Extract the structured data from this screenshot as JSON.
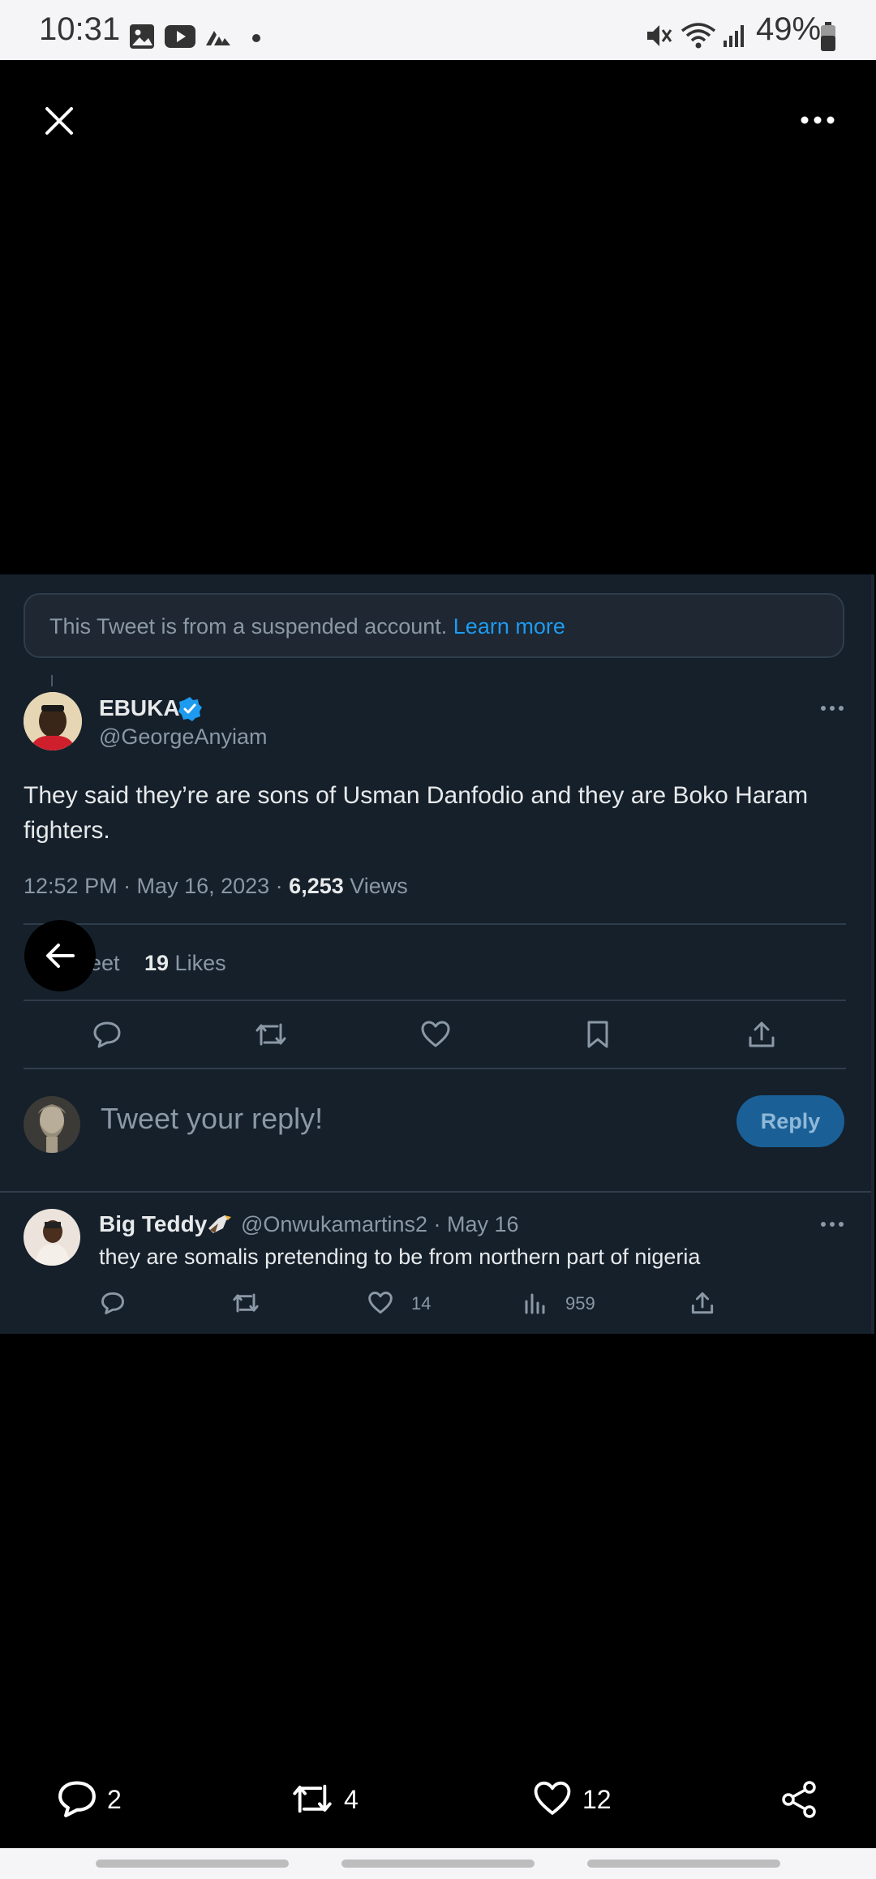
{
  "status_bar": {
    "time": "10:31",
    "battery": "49%"
  },
  "tweet": {
    "suspended_notice": "This Tweet is from a suspended account.",
    "learn_more": "Learn more",
    "author_name": "EBUKA",
    "author_handle": "@GeorgeAnyiam",
    "text": "They said they’re are sons of Usman Danfodio and they are Boko Haram fighters.",
    "timestamp": "12:52 PM · May 16, 2023 · ",
    "views_count": "6,253",
    "views_label": " Views",
    "retweets_partial": "eet",
    "likes_count": "19",
    "likes_label": " Likes"
  },
  "reply_box": {
    "placeholder": "Tweet your reply!",
    "button": "Reply"
  },
  "reply_tweet": {
    "author_name": "Big Teddy",
    "author_handle": "@Onwukamartins2 · May 16",
    "text": "they are somalis pretending to be from northern part of nigeria",
    "likes": "14",
    "views": "959"
  },
  "bottom_bar": {
    "comments": "2",
    "retweets": "4",
    "likes": "12"
  },
  "colors": {
    "card_bg": "#15202b",
    "accent": "#1d9bf0",
    "verified": "#1d9bf0"
  }
}
